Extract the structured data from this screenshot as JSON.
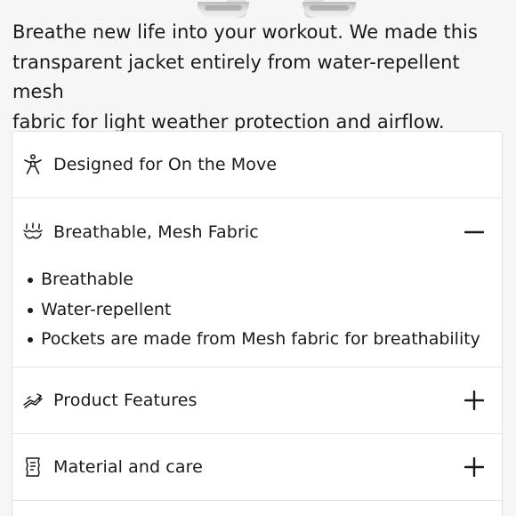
{
  "description": "Breathe new life into your workout. We made this\ntransparent jacket entirely from water-repellent mesh\nfabric for light weather protection and airflow.",
  "accordion": {
    "items": [
      {
        "label": "Designed for On the Move",
        "icon": "person-activity-icon",
        "state": "none"
      },
      {
        "label": "Breathable, Mesh Fabric",
        "icon": "breathable-waves-icon",
        "state": "expanded",
        "bullets": [
          "Breathable",
          "Water-repellent",
          "Pockets are made from Mesh fabric for breathability"
        ]
      },
      {
        "label": "Product Features",
        "icon": "product-features-icon",
        "state": "collapsed"
      },
      {
        "label": "Material and care",
        "icon": "care-label-icon",
        "state": "collapsed"
      }
    ]
  },
  "colors": {
    "background": "#f6f6f6",
    "card": "#ffffff",
    "text": "#1a1a1a",
    "divider": "#e3e3e3"
  }
}
